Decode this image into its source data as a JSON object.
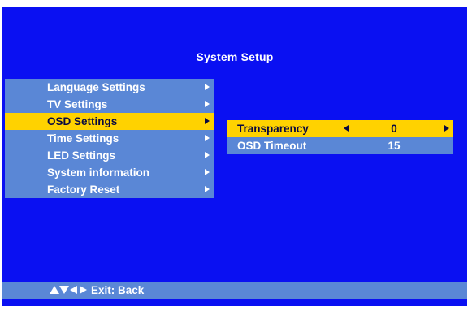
{
  "title": "System Setup",
  "menu": {
    "items": [
      {
        "label": "Language Settings",
        "selected": false
      },
      {
        "label": "TV Settings",
        "selected": false
      },
      {
        "label": "OSD Settings",
        "selected": true
      },
      {
        "label": "Time Settings",
        "selected": false
      },
      {
        "label": "LED Settings",
        "selected": false
      },
      {
        "label": "System information",
        "selected": false
      },
      {
        "label": "Factory Reset",
        "selected": false
      }
    ]
  },
  "osd_settings": {
    "rows": [
      {
        "label": "Transparency",
        "value": "0",
        "selected": true
      },
      {
        "label": "OSD Timeout",
        "value": "15",
        "selected": false
      }
    ]
  },
  "footer": {
    "icons": [
      "up-arrow-icon",
      "down-arrow-icon",
      "left-arrow-icon",
      "right-arrow-icon"
    ],
    "label": "Exit: Back"
  },
  "colors": {
    "background": "#0a10f2",
    "panel": "#5a87d6",
    "highlight": "#ffd200",
    "text": "#ffffff",
    "highlight_text": "#0a0a40"
  }
}
